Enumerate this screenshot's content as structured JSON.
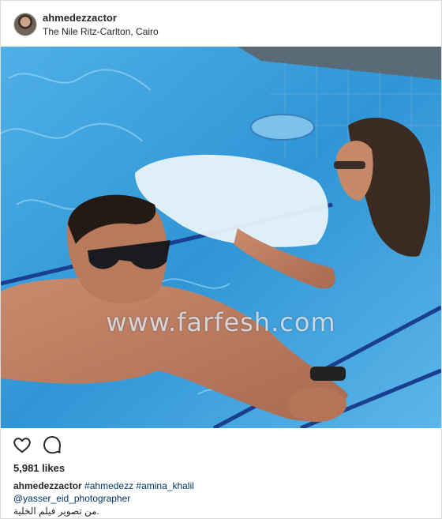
{
  "header": {
    "username": "ahmedezzactor",
    "location": "The Nile Ritz-Carlton, Cairo",
    "avatar_icon": "profile-avatar"
  },
  "photo": {
    "watermark": "www.farfesh.com"
  },
  "actions": {
    "like_icon": "heart-outline-icon",
    "comment_icon": "speech-bubble-icon"
  },
  "likes": "5,981 likes",
  "caption": {
    "username": "ahmedezzactor",
    "hashtags": "#ahmedezz #amina_khalil",
    "mention": "@yasser_eid_photographer",
    "text": ".من تصوير فيلم الخلية"
  },
  "colors": {
    "pool": "#2a8fd0",
    "tile_line": "#1a3f8f",
    "text": "#262626",
    "link": "#003569"
  }
}
